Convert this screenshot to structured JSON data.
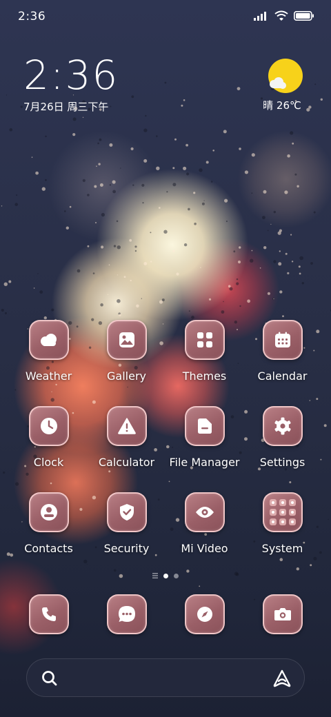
{
  "status_bar": {
    "time": "2:36"
  },
  "clock_widget": {
    "time": "2:36",
    "date": "7月26日 周三下午"
  },
  "weather_widget": {
    "condition_temp": "晴 26℃"
  },
  "apps": [
    {
      "label": "Weather",
      "icon": "cloud-icon"
    },
    {
      "label": "Gallery",
      "icon": "image-icon"
    },
    {
      "label": "Themes",
      "icon": "grid-icon"
    },
    {
      "label": "Calendar",
      "icon": "calendar-icon"
    },
    {
      "label": "Clock",
      "icon": "clock-icon"
    },
    {
      "label": "Calculator",
      "icon": "warning-icon"
    },
    {
      "label": "File Manager",
      "icon": "folder-icon"
    },
    {
      "label": "Settings",
      "icon": "gear-icon"
    },
    {
      "label": "Contacts",
      "icon": "person-icon"
    },
    {
      "label": "Security",
      "icon": "shield-icon"
    },
    {
      "label": "Mi Video",
      "icon": "eye-icon"
    },
    {
      "label": "System",
      "icon": "folder-grid-icon"
    }
  ],
  "dock": [
    {
      "icon": "phone-icon"
    },
    {
      "icon": "message-icon"
    },
    {
      "icon": "compass-icon"
    },
    {
      "icon": "camera-icon"
    }
  ],
  "page_indicator": {
    "count": 2,
    "active": 0
  },
  "colors": {
    "icon_bg": "#9a5f67",
    "icon_border": "#ffd7d7",
    "sun": "#f7d21a"
  }
}
